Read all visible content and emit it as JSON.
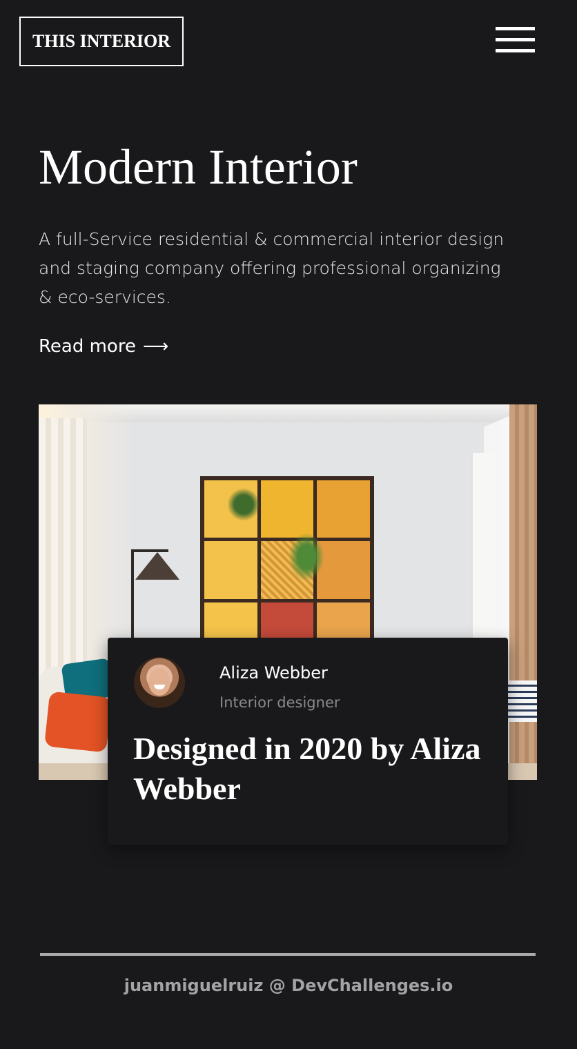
{
  "header": {
    "logo_text": "THIS INTERIOR",
    "menu_icon": "hamburger-menu-icon"
  },
  "hero": {
    "title": "Modern Interior",
    "description": "A full-Service residential & commercial interior design and staging company offering professional organizing & eco-services.",
    "read_more_label": "Read more",
    "read_more_arrow": "⟶"
  },
  "feature_card": {
    "author_name": "Aliza Webber",
    "author_role": "Interior designer",
    "title": "Designed in 2020 by Aliza Webber"
  },
  "footer": {
    "credit": "juanmiguelruiz @ DevChallenges.io"
  },
  "colors": {
    "background": "#19191b",
    "text": "#ffffff",
    "muted": "#8a8a8c",
    "footer_text": "#a3a3a5"
  }
}
